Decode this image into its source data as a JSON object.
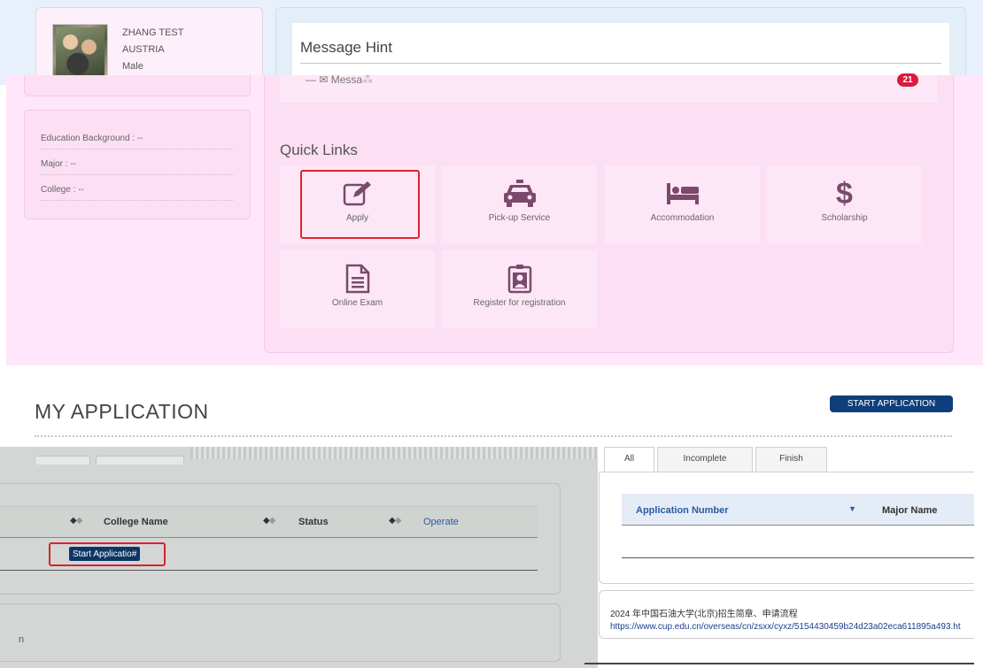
{
  "profile": {
    "name": "ZHANG TEST",
    "country": "AUSTRIA",
    "gender": "Male"
  },
  "education": {
    "background": "Education Background : --",
    "major": "Major : --",
    "college": "College : --"
  },
  "messages": {
    "title": "Message Hint",
    "link_label": "Messa",
    "unread_count": "21",
    "icon": "envelope-icon"
  },
  "quick_links": {
    "title": "Quick Links",
    "items": [
      {
        "label": "Apply",
        "icon": "edit-icon"
      },
      {
        "label": "Pick-up Service",
        "icon": "taxi-icon"
      },
      {
        "label": "Accommodation",
        "icon": "bed-icon"
      },
      {
        "label": "Scholarship",
        "icon": "dollar-icon"
      },
      {
        "label": "Online Exam",
        "icon": "document-icon"
      },
      {
        "label": "Register for registration",
        "icon": "id-badge-icon"
      }
    ]
  },
  "applications": {
    "title": "MY APPLICATION",
    "start_button": "START APPLICATION",
    "left_table": {
      "columns": [
        "College Name",
        "Status",
        "Operate"
      ],
      "row_action": "Start Applicatio#"
    },
    "trailing_char": "n",
    "tabs": [
      "All",
      "Incomplete",
      "Finish"
    ],
    "right_table": {
      "columns": [
        "Application Number",
        "Major Name"
      ]
    },
    "notice": {
      "title": "2024 年中国石油大学(北京)招生简章、申请流程",
      "link": "https://www.cup.edu.cn/overseas/cn/zsxx/cyxz/5154430459b24d23a02eca611895a493.ht"
    }
  },
  "colors": {
    "accent_button": "#0e3e7c",
    "badge": "#d81b3c",
    "highlight_border": "#e0222c",
    "icon_color": "#7b4a6a",
    "link": "#1a3e8c"
  }
}
